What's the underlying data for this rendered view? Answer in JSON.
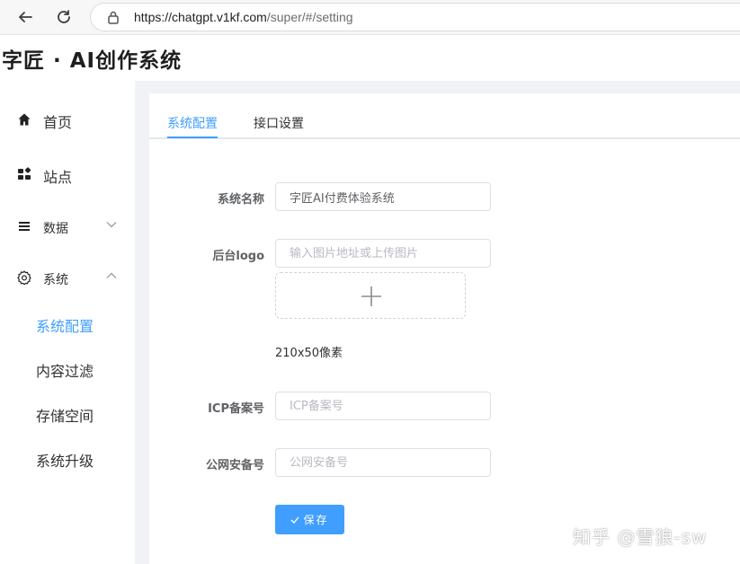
{
  "browser": {
    "url_host": "https://chatgpt.v1kf.com",
    "url_path": "/super/#/setting"
  },
  "app": {
    "title": "字匠 · AI创作系统"
  },
  "sidebar": {
    "items": [
      {
        "label": "首页",
        "icon": "home-icon"
      },
      {
        "label": "站点",
        "icon": "grid-icon"
      },
      {
        "label": "数据",
        "icon": "list-icon"
      },
      {
        "label": "系统",
        "icon": "gear-icon"
      }
    ],
    "sub_items": [
      {
        "label": "系统配置",
        "active": true
      },
      {
        "label": "内容过滤"
      },
      {
        "label": "存储空间"
      },
      {
        "label": "系统升级"
      }
    ]
  },
  "tabs": [
    {
      "label": "系统配置",
      "active": true
    },
    {
      "label": "接口设置"
    }
  ],
  "form": {
    "system_name": {
      "label": "系统名称",
      "value": "字匠AI付费体验系统"
    },
    "logo": {
      "label": "后台logo",
      "placeholder": "输入图片地址或上传图片",
      "hint": "210x50像素"
    },
    "icp": {
      "label": "ICP备案号",
      "placeholder": "ICP备案号"
    },
    "police": {
      "label": "公网安备号",
      "placeholder": "公网安备号"
    },
    "save_label": "保存"
  },
  "watermark": "知乎 @雪狼-sw",
  "colors": {
    "accent": "#409eff",
    "main_bg": "#f0f2f5"
  }
}
